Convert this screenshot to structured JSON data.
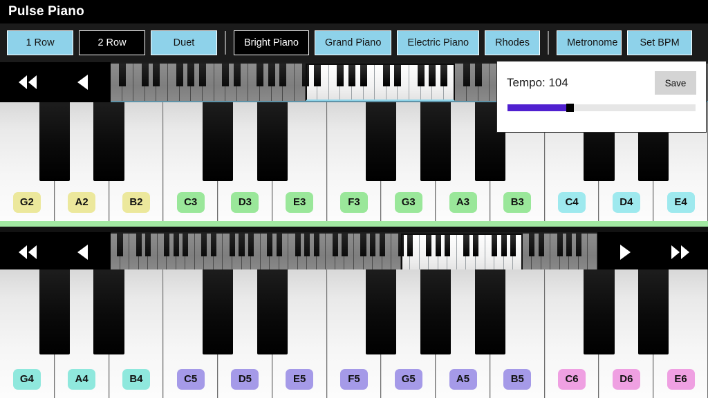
{
  "header": {
    "title": "Pulse Piano"
  },
  "toolbar": {
    "layout_buttons": [
      {
        "label": "1 Row",
        "selected": false
      },
      {
        "label": "2 Row",
        "selected": true
      },
      {
        "label": "Duet",
        "selected": false
      }
    ],
    "instrument_buttons": [
      {
        "label": "Bright Piano",
        "selected": true
      },
      {
        "label": "Grand Piano",
        "selected": false
      },
      {
        "label": "Electric Piano",
        "selected": false
      },
      {
        "label": "Rhodes",
        "selected": false
      }
    ],
    "tempo_buttons": [
      {
        "label": "Metronome",
        "selected": false
      },
      {
        "label": "Set BPM",
        "selected": false
      }
    ],
    "colors": {
      "accent": "#8ed2ea",
      "selected_bg": "#000000",
      "border": "#ffffff"
    }
  },
  "tempo_popup": {
    "visible": true,
    "label": "Tempo: 104",
    "bpm": 104,
    "save_label": "Save",
    "slider_percent": 33,
    "slider_fill_color": "#5020d0",
    "slider_track_color": "#e6e6e6"
  },
  "rows": [
    {
      "name": "row-1",
      "nav": {
        "left": [
          "rewind-icon",
          "previous-icon"
        ],
        "right": []
      },
      "overview": {
        "total_white_keys": 52,
        "view_start_index": 17,
        "view_white_keys": 13
      },
      "keys": [
        {
          "note": "G2",
          "label_color": "#ece89c"
        },
        {
          "note": "A2",
          "label_color": "#ece89c"
        },
        {
          "note": "B2",
          "label_color": "#ece89c"
        },
        {
          "note": "C3",
          "label_color": "#9ae79a"
        },
        {
          "note": "D3",
          "label_color": "#9ae79a"
        },
        {
          "note": "E3",
          "label_color": "#9ae79a"
        },
        {
          "note": "F3",
          "label_color": "#9ae79a"
        },
        {
          "note": "G3",
          "label_color": "#9ae79a"
        },
        {
          "note": "A3",
          "label_color": "#9ae79a"
        },
        {
          "note": "B3",
          "label_color": "#9ae79a"
        },
        {
          "note": "C4",
          "label_color": "#9ee9ee"
        },
        {
          "note": "D4",
          "label_color": "#9ee9ee"
        },
        {
          "note": "E4",
          "label_color": "#9ee9ee"
        }
      ],
      "black_key_after": [
        0,
        1,
        3,
        4,
        6,
        7,
        8,
        10,
        11
      ]
    },
    {
      "name": "row-2",
      "nav": {
        "left": [
          "rewind-icon",
          "previous-icon"
        ],
        "right": [
          "next-icon",
          "forward-icon"
        ]
      },
      "overview": {
        "total_white_keys": 52,
        "view_start_index": 31,
        "view_white_keys": 13
      },
      "keys": [
        {
          "note": "G4",
          "label_color": "#8fe8dd"
        },
        {
          "note": "A4",
          "label_color": "#8fe8dd"
        },
        {
          "note": "B4",
          "label_color": "#8fe8dd"
        },
        {
          "note": "C5",
          "label_color": "#a59ae8"
        },
        {
          "note": "D5",
          "label_color": "#a59ae8"
        },
        {
          "note": "E5",
          "label_color": "#a59ae8"
        },
        {
          "note": "F5",
          "label_color": "#a59ae8"
        },
        {
          "note": "G5",
          "label_color": "#a59ae8"
        },
        {
          "note": "A5",
          "label_color": "#a59ae8"
        },
        {
          "note": "B5",
          "label_color": "#a59ae8"
        },
        {
          "note": "C6",
          "label_color": "#efa0e2"
        },
        {
          "note": "D6",
          "label_color": "#efa0e2"
        },
        {
          "note": "E6",
          "label_color": "#efa0e2"
        }
      ],
      "black_key_after": [
        0,
        1,
        3,
        4,
        6,
        7,
        8,
        10,
        11
      ]
    }
  ],
  "separator_color": "#a2e8a2"
}
